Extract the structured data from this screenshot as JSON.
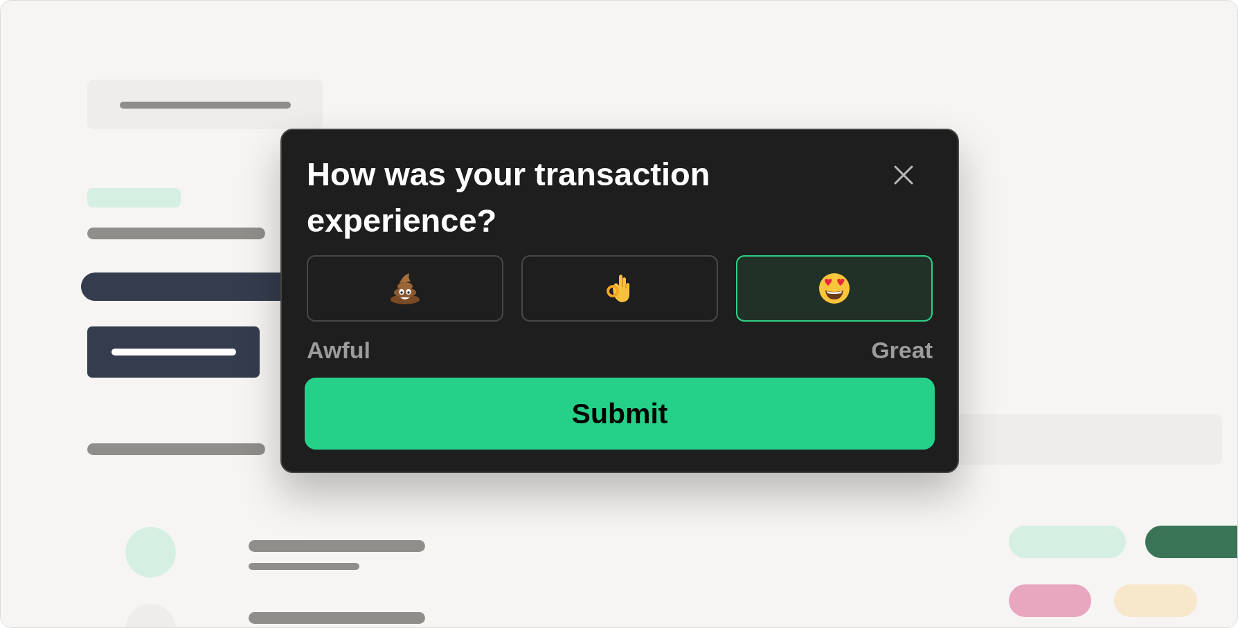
{
  "dialog": {
    "title": "How was your transaction experience?",
    "options": [
      {
        "kind": "poop",
        "selected": false
      },
      {
        "kind": "ok-hand",
        "selected": false
      },
      {
        "kind": "heart-eyes",
        "selected": true
      }
    ],
    "scale_labels": [
      "Awful",
      "Great"
    ],
    "submit": "Submit"
  }
}
